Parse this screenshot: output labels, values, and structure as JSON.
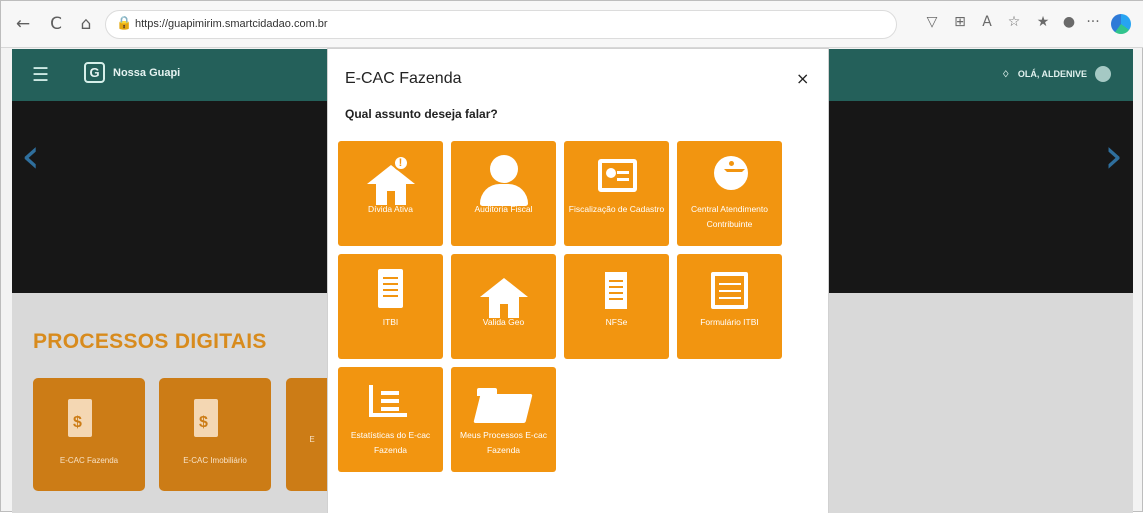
{
  "browser": {
    "back": "←",
    "refresh": "C",
    "home": "⌂",
    "url": "https://guapimirim.smartcidadao.com.br",
    "tool_icons": [
      "▽",
      "⊞",
      "A",
      "☆",
      "★",
      "●",
      "···"
    ]
  },
  "site": {
    "header": {
      "brand": "Nossa Guapi",
      "user": "OLÁ, ALDENIVE"
    },
    "section_title": "PROCESSOS DIGITAIS",
    "cards": [
      "E-CAC Fazenda",
      "E-CAC Imobiliário",
      "E"
    ]
  },
  "modal": {
    "title": "E-CAC Fazenda",
    "close": "×",
    "question": "Qual assunto deseja falar?",
    "tiles": [
      {
        "label": "Dívida Ativa",
        "icon": "house-alert-icon"
      },
      {
        "label": "Auditoria Fiscal",
        "icon": "person-icon"
      },
      {
        "label": "Fiscalização de Cadastro",
        "icon": "id-card-icon"
      },
      {
        "label": "Central Atendimento Contribuinte",
        "icon": "accessibility-icon"
      },
      {
        "label": "ITBI",
        "icon": "document-icon"
      },
      {
        "label": "Valida Geo",
        "icon": "home-icon"
      },
      {
        "label": "NFSe",
        "icon": "receipt-icon"
      },
      {
        "label": "Formulário ITBI",
        "icon": "form-icon"
      },
      {
        "label": "Estatísticas do E-cac Fazenda",
        "icon": "bar-chart-icon"
      },
      {
        "label": "Meus Processos E-cac Fazenda",
        "icon": "folder-icon"
      }
    ]
  }
}
